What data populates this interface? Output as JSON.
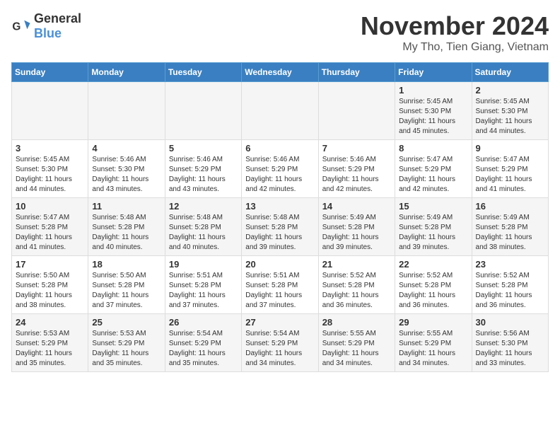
{
  "logo": {
    "general": "General",
    "blue": "Blue"
  },
  "title": "November 2024",
  "subtitle": "My Tho, Tien Giang, Vietnam",
  "days_of_week": [
    "Sunday",
    "Monday",
    "Tuesday",
    "Wednesday",
    "Thursday",
    "Friday",
    "Saturday"
  ],
  "weeks": [
    [
      {
        "day": "",
        "content": ""
      },
      {
        "day": "",
        "content": ""
      },
      {
        "day": "",
        "content": ""
      },
      {
        "day": "",
        "content": ""
      },
      {
        "day": "",
        "content": ""
      },
      {
        "day": "1",
        "content": "Sunrise: 5:45 AM\nSunset: 5:30 PM\nDaylight: 11 hours and 45 minutes."
      },
      {
        "day": "2",
        "content": "Sunrise: 5:45 AM\nSunset: 5:30 PM\nDaylight: 11 hours and 44 minutes."
      }
    ],
    [
      {
        "day": "3",
        "content": "Sunrise: 5:45 AM\nSunset: 5:30 PM\nDaylight: 11 hours and 44 minutes."
      },
      {
        "day": "4",
        "content": "Sunrise: 5:46 AM\nSunset: 5:30 PM\nDaylight: 11 hours and 43 minutes."
      },
      {
        "day": "5",
        "content": "Sunrise: 5:46 AM\nSunset: 5:29 PM\nDaylight: 11 hours and 43 minutes."
      },
      {
        "day": "6",
        "content": "Sunrise: 5:46 AM\nSunset: 5:29 PM\nDaylight: 11 hours and 42 minutes."
      },
      {
        "day": "7",
        "content": "Sunrise: 5:46 AM\nSunset: 5:29 PM\nDaylight: 11 hours and 42 minutes."
      },
      {
        "day": "8",
        "content": "Sunrise: 5:47 AM\nSunset: 5:29 PM\nDaylight: 11 hours and 42 minutes."
      },
      {
        "day": "9",
        "content": "Sunrise: 5:47 AM\nSunset: 5:29 PM\nDaylight: 11 hours and 41 minutes."
      }
    ],
    [
      {
        "day": "10",
        "content": "Sunrise: 5:47 AM\nSunset: 5:28 PM\nDaylight: 11 hours and 41 minutes."
      },
      {
        "day": "11",
        "content": "Sunrise: 5:48 AM\nSunset: 5:28 PM\nDaylight: 11 hours and 40 minutes."
      },
      {
        "day": "12",
        "content": "Sunrise: 5:48 AM\nSunset: 5:28 PM\nDaylight: 11 hours and 40 minutes."
      },
      {
        "day": "13",
        "content": "Sunrise: 5:48 AM\nSunset: 5:28 PM\nDaylight: 11 hours and 39 minutes."
      },
      {
        "day": "14",
        "content": "Sunrise: 5:49 AM\nSunset: 5:28 PM\nDaylight: 11 hours and 39 minutes."
      },
      {
        "day": "15",
        "content": "Sunrise: 5:49 AM\nSunset: 5:28 PM\nDaylight: 11 hours and 39 minutes."
      },
      {
        "day": "16",
        "content": "Sunrise: 5:49 AM\nSunset: 5:28 PM\nDaylight: 11 hours and 38 minutes."
      }
    ],
    [
      {
        "day": "17",
        "content": "Sunrise: 5:50 AM\nSunset: 5:28 PM\nDaylight: 11 hours and 38 minutes."
      },
      {
        "day": "18",
        "content": "Sunrise: 5:50 AM\nSunset: 5:28 PM\nDaylight: 11 hours and 37 minutes."
      },
      {
        "day": "19",
        "content": "Sunrise: 5:51 AM\nSunset: 5:28 PM\nDaylight: 11 hours and 37 minutes."
      },
      {
        "day": "20",
        "content": "Sunrise: 5:51 AM\nSunset: 5:28 PM\nDaylight: 11 hours and 37 minutes."
      },
      {
        "day": "21",
        "content": "Sunrise: 5:52 AM\nSunset: 5:28 PM\nDaylight: 11 hours and 36 minutes."
      },
      {
        "day": "22",
        "content": "Sunrise: 5:52 AM\nSunset: 5:28 PM\nDaylight: 11 hours and 36 minutes."
      },
      {
        "day": "23",
        "content": "Sunrise: 5:52 AM\nSunset: 5:28 PM\nDaylight: 11 hours and 36 minutes."
      }
    ],
    [
      {
        "day": "24",
        "content": "Sunrise: 5:53 AM\nSunset: 5:29 PM\nDaylight: 11 hours and 35 minutes."
      },
      {
        "day": "25",
        "content": "Sunrise: 5:53 AM\nSunset: 5:29 PM\nDaylight: 11 hours and 35 minutes."
      },
      {
        "day": "26",
        "content": "Sunrise: 5:54 AM\nSunset: 5:29 PM\nDaylight: 11 hours and 35 minutes."
      },
      {
        "day": "27",
        "content": "Sunrise: 5:54 AM\nSunset: 5:29 PM\nDaylight: 11 hours and 34 minutes."
      },
      {
        "day": "28",
        "content": "Sunrise: 5:55 AM\nSunset: 5:29 PM\nDaylight: 11 hours and 34 minutes."
      },
      {
        "day": "29",
        "content": "Sunrise: 5:55 AM\nSunset: 5:29 PM\nDaylight: 11 hours and 34 minutes."
      },
      {
        "day": "30",
        "content": "Sunrise: 5:56 AM\nSunset: 5:30 PM\nDaylight: 11 hours and 33 minutes."
      }
    ]
  ]
}
